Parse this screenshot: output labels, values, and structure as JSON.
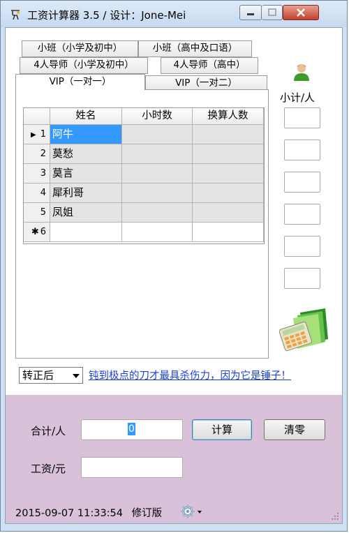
{
  "window": {
    "title": "工资计算器 3.5 /  设计：Jone-Mei"
  },
  "tabs": {
    "row1": [
      "小班（小学及初中）",
      "小班（高中及口语）"
    ],
    "row2": [
      "4人导师（小学及初中）",
      "4人导师（高中）"
    ],
    "row3": [
      "VIP（一对一）",
      "VIP（一对二）"
    ],
    "active": "VIP（一对一）"
  },
  "grid": {
    "columns": [
      "姓名",
      "小时数",
      "换算人数"
    ],
    "rows": [
      {
        "num": "1",
        "name": "阿牛",
        "hours": "",
        "count": "",
        "current": true
      },
      {
        "num": "2",
        "name": "莫愁",
        "hours": "",
        "count": ""
      },
      {
        "num": "3",
        "name": "莫言",
        "hours": "",
        "count": ""
      },
      {
        "num": "4",
        "name": "犀利哥",
        "hours": "",
        "count": ""
      },
      {
        "num": "5",
        "name": "凤姐",
        "hours": "",
        "count": ""
      },
      {
        "num": "6",
        "name": "",
        "hours": "",
        "count": "",
        "new_row": true
      }
    ],
    "current_marker": "▶",
    "new_row_marker": "✱"
  },
  "subtotal": {
    "label": "小计/人",
    "icon": "user-icon",
    "values": [
      "",
      "",
      "",
      "",
      "",
      ""
    ]
  },
  "mode_select": {
    "value": "转正后"
  },
  "slogan": "钝到极点的刀才最具杀伤力，因为它是锤子！",
  "illustration": "calculator-folder-icon",
  "totals": {
    "total_label": "合计/人",
    "total_value": "0",
    "calc_button": "计算",
    "clear_button": "清零",
    "salary_label": "工资/元",
    "salary_value": ""
  },
  "status": {
    "datetime": "2015-09-07 11:33:54",
    "edition": "修订版",
    "settings_icon": "gear-icon"
  },
  "colors": {
    "selection": "#3399ff",
    "link": "#1a3fd9",
    "bottom_panel": "#d9c1d9"
  }
}
